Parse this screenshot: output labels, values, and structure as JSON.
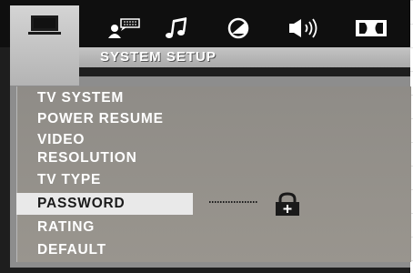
{
  "icons": [
    {
      "name": "monitor-icon",
      "active": true
    },
    {
      "name": "speaker-person-icon",
      "active": false
    },
    {
      "name": "music-note-icon",
      "active": false
    },
    {
      "name": "disc-icon",
      "active": false
    },
    {
      "name": "volume-icon",
      "active": false
    },
    {
      "name": "dolby-icon",
      "active": false
    }
  ],
  "header": {
    "title": "SYSTEM SETUP"
  },
  "menu": {
    "items": [
      {
        "label": "TV SYSTEM"
      },
      {
        "label": "POWER RESUME"
      },
      {
        "label": "VIDEO"
      },
      {
        "label": "RESOLUTION"
      },
      {
        "label": "TV TYPE"
      },
      {
        "label": "PASSWORD"
      },
      {
        "label": "RATING"
      },
      {
        "label": "DEFAULT"
      }
    ],
    "selected_index": 5
  },
  "password": {
    "status_icon": "lock-icon"
  },
  "colors": {
    "background": "#1e1e1e",
    "panel": "#8f8c87",
    "selection": "#e9e9e9",
    "text": "#ffffff"
  }
}
